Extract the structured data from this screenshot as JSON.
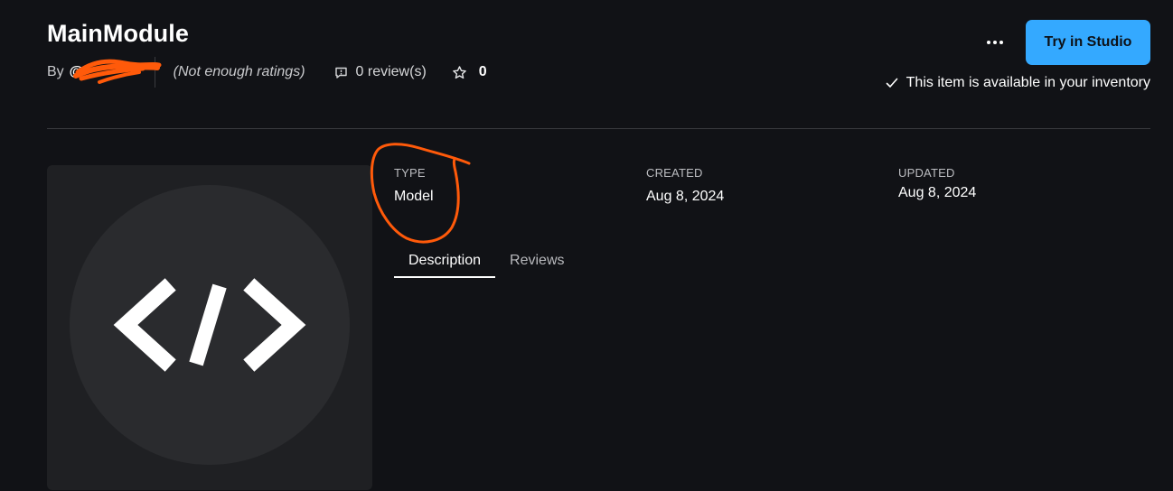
{
  "item": {
    "title": "MainModule",
    "by_label": "By",
    "creator": "@",
    "ratings": "(Not enough ratings)",
    "reviews_count": "0 review(s)",
    "favorites_count": "0"
  },
  "actions": {
    "try_label": "Try in Studio",
    "inventory_status": "This item is available in your inventory"
  },
  "details": {
    "type": {
      "label": "TYPE",
      "value": "Model"
    },
    "created": {
      "label": "CREATED",
      "value": "Aug 8, 2024"
    },
    "updated": {
      "label": "UPDATED",
      "value": "Aug 8, 2024"
    }
  },
  "tabs": [
    {
      "label": "Description",
      "active": true
    },
    {
      "label": "Reviews",
      "active": false
    }
  ],
  "icons": {
    "thumbnail": "code-brackets-icon",
    "reviews": "comment-icon",
    "favorites": "star-icon",
    "more": "more-options-icon",
    "inventory": "checkmark-icon"
  },
  "colors": {
    "background": "#111216",
    "accent": "#34a9ff",
    "annotation": "#ff5a0a",
    "thumbnail_bg": "#1f2023"
  }
}
